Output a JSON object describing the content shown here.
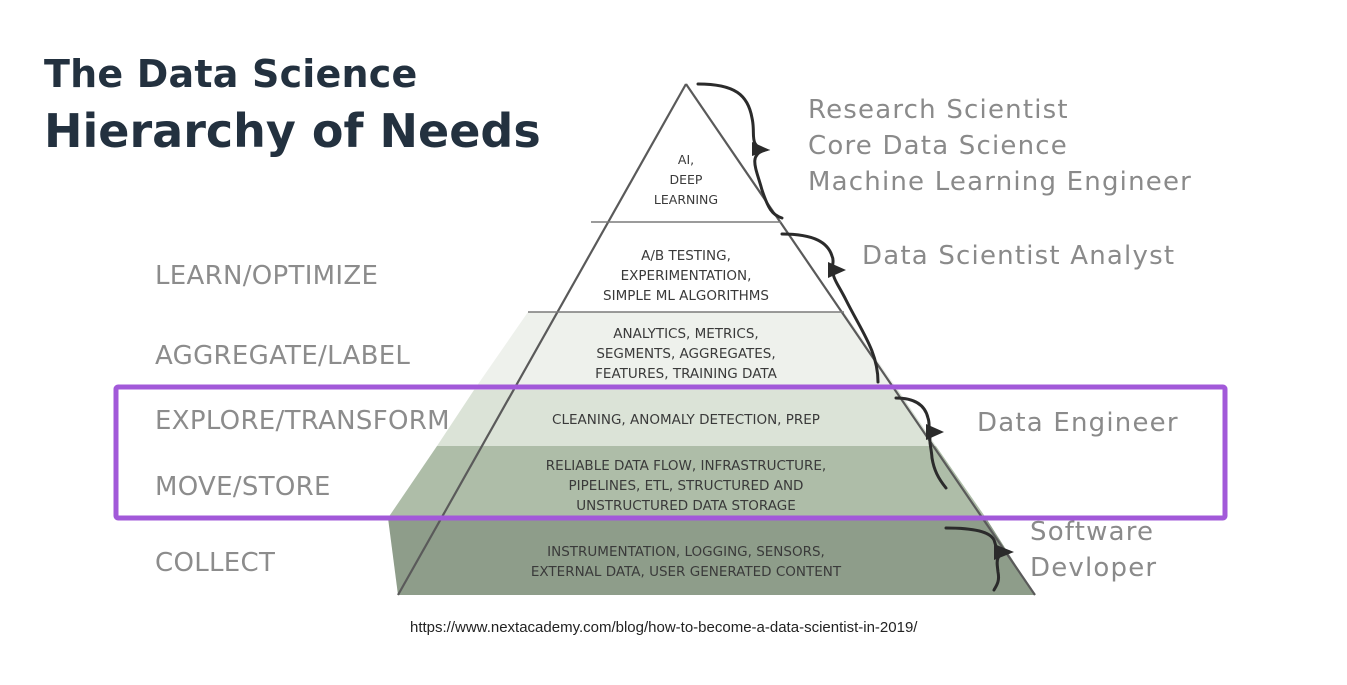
{
  "title": {
    "line1": "The Data Science",
    "line2": "Hierarchy of Needs"
  },
  "stages": [
    {
      "id": "learn",
      "label": "LEARN/OPTIMIZE"
    },
    {
      "id": "aggregate",
      "label": "AGGREGATE/LABEL"
    },
    {
      "id": "explore",
      "label": "EXPLORE/TRANSFORM"
    },
    {
      "id": "move",
      "label": "MOVE/STORE"
    },
    {
      "id": "collect",
      "label": "COLLECT"
    }
  ],
  "tiers": [
    {
      "lines": [
        "AI,",
        "DEEP",
        "LEARNING"
      ],
      "fill": "#ffffff"
    },
    {
      "lines": [
        "A/B TESTING,",
        "EXPERIMENTATION,",
        "SIMPLE ML ALGORITHMS"
      ],
      "fill": "#ffffff"
    },
    {
      "lines": [
        "ANALYTICS, METRICS,",
        "SEGMENTS, AGGREGATES,",
        "FEATURES, TRAINING DATA"
      ],
      "fill": "#eef1ec"
    },
    {
      "lines": [
        "CLEANING, ANOMALY DETECTION, PREP"
      ],
      "fill": "#dbe3d7"
    },
    {
      "lines": [
        "RELIABLE DATA FLOW, INFRASTRUCTURE,",
        "PIPELINES, ETL, STRUCTURED AND",
        "UNSTRUCTURED DATA STORAGE"
      ],
      "fill": "#aebda8"
    },
    {
      "lines": [
        "INSTRUMENTATION, LOGGING, SENSORS,",
        "EXTERNAL DATA, USER GENERATED CONTENT"
      ],
      "fill": "#8e9d8a"
    }
  ],
  "roles": {
    "top": [
      "Research Scientist",
      "Core Data Science",
      "Machine Learning Engineer"
    ],
    "analyst": [
      "Data Scientist Analyst"
    ],
    "engineer": [
      "Data Engineer"
    ],
    "developer": [
      "Software",
      "Devloper"
    ]
  },
  "highlight_color": "#a259d9",
  "source_url": "https://www.nextacademy.com/blog/how-to-become-a-data-scientist-in-2019/"
}
